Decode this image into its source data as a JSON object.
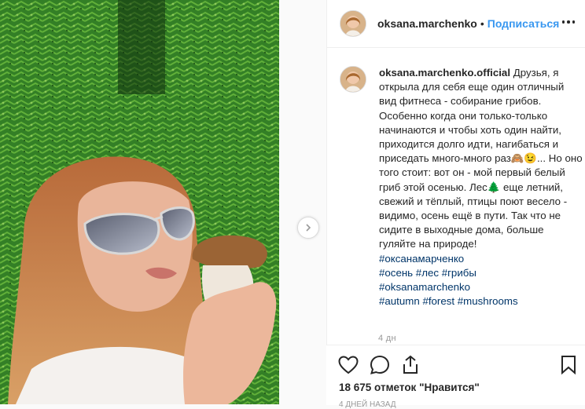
{
  "post": {
    "username": "oksana.marchenko",
    "follow_label": "Подписаться",
    "separator": "•"
  },
  "caption": {
    "username": "oksana.marchenko.official",
    "text": "Друзья, я открыла для себя еще один отличный вид фитнеса - собирание грибов. Особенно когда они только-только начинаются и чтобы хоть один найти, приходится долго идти, нагибаться и приседать много-много раз🙈😉... Но оно того стоит: вот он - мой первый белый гриб этой осенью. Лес🌲 еще летний, свежий и тёплый, птицы поют весело - видимо, осень ещё в пути. Так что не сидите в выходные дома, больше гуляйте на природе!",
    "hashtags": [
      "#оксанамарченко",
      "#осень #лес #грибы",
      "#oksanamarchenko",
      "#autumn #forest #mushrooms"
    ]
  },
  "meta": {
    "comment_time": "4 дн",
    "likes": "18 675 отметок \"Нравится\"",
    "post_date": "4 ДНЕЙ НАЗАД"
  },
  "icons": {
    "like": "heart-icon",
    "comment": "comment-icon",
    "share": "share-icon",
    "save": "bookmark-icon",
    "more": "more-icon",
    "next": "chevron-right-icon"
  },
  "colors": {
    "link": "#3897f0",
    "hashtag": "#003569",
    "text": "#262626",
    "muted": "#999999"
  }
}
